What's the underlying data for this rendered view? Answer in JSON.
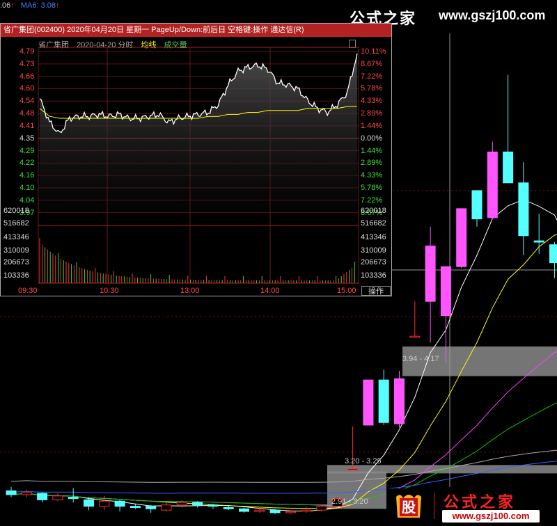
{
  "top_bar": {
    "ma_prefix": ".06",
    "ma5_label": "MA6: 3.08",
    "arrow": "↑"
  },
  "watermark_top": {
    "cn": "公式之家",
    "url": "www.gszj100.com"
  },
  "watermark_bottom": {
    "cn": "公式之家",
    "url": "www.gszj100.com",
    "seal_char": "股"
  },
  "zones": [
    {
      "label": "3.94 - 4.17"
    },
    {
      "label": "3.20 - 3.25"
    },
    {
      "label": "2.91 - 3.20"
    }
  ],
  "popup": {
    "title": "省广集团(002400) 2020年04月20日 星期一 PageUp/Down:前后日 空格键:操作 通达信(R)",
    "stock_name": "省广集团",
    "date": "2020-04-20 分时",
    "avg_label": "均线",
    "vol_label": "成交量",
    "price_labels": [
      "4.79",
      "4.73",
      "4.66",
      "4.60",
      "4.54",
      "4.48",
      "4.41",
      "4.35",
      "4.29",
      "4.22",
      "4.16",
      "4.10",
      "4.04",
      "3.97"
    ],
    "pct_labels": [
      "10.11%",
      "8.67%",
      "7.22%",
      "5.78%",
      "4.33%",
      "2.89%",
      "1.44%",
      "0.00%",
      "1.44%",
      "2.89%",
      "4.33%",
      "5.78%",
      "7.22%",
      "8.67%"
    ],
    "vol_labels": [
      "620018",
      "516682",
      "413346",
      "310009",
      "206673",
      "103336"
    ],
    "time_labels": [
      "09:30",
      "10:30",
      "13:00",
      "14:00",
      "15:00"
    ],
    "op_button": "操作"
  },
  "colors": {
    "up": "#ff55ff",
    "down": "#55ffff",
    "up_price_label": "#ff4a4a",
    "down_price_label": "#3fe03f",
    "title_bar": "#b22222",
    "avg_line": "#ffff00"
  },
  "chart_data": [
    {
      "type": "candlestick",
      "candles": [
        [
          3.05,
          3.02,
          3.08,
          3.0
        ],
        [
          3.02,
          3.04,
          3.06,
          3.0
        ],
        [
          3.03,
          2.98,
          3.04,
          2.96
        ],
        [
          2.98,
          3.01,
          3.03,
          2.97
        ],
        [
          3.0,
          2.99,
          3.07,
          2.96
        ],
        [
          2.98,
          2.93,
          3.0,
          2.9
        ],
        [
          2.93,
          2.97,
          3.01,
          2.9
        ],
        [
          2.97,
          2.93,
          2.98,
          2.89
        ],
        [
          2.93,
          2.92,
          2.95,
          2.91
        ],
        [
          2.93,
          2.91,
          2.94,
          2.88
        ],
        [
          2.9,
          2.94,
          2.96,
          2.89
        ],
        [
          2.94,
          2.96,
          2.98,
          2.92
        ],
        [
          2.96,
          2.94,
          2.97,
          2.92
        ],
        [
          2.94,
          2.93,
          2.95,
          2.91
        ],
        [
          2.92,
          2.91,
          2.93,
          2.9
        ],
        [
          2.91,
          2.89,
          2.92,
          2.88
        ],
        [
          2.89,
          2.9,
          2.92,
          2.88
        ],
        [
          2.9,
          2.88,
          2.91,
          2.87
        ],
        [
          2.88,
          2.89,
          2.9,
          2.87
        ],
        [
          2.89,
          2.9,
          2.93,
          2.88
        ],
        [
          2.9,
          2.93,
          2.94,
          2.89
        ],
        [
          2.93,
          2.99,
          3.0,
          2.92
        ],
        [
          3.22,
          3.22,
          3.55,
          3.22
        ],
        [
          3.56,
          3.91,
          3.91,
          3.56
        ],
        [
          3.91,
          3.58,
          3.99,
          3.56
        ],
        [
          3.57,
          3.92,
          3.98,
          3.54
        ],
        [
          4.25,
          4.25,
          4.52,
          4.25
        ],
        [
          4.52,
          4.95,
          5.1,
          4.2
        ],
        [
          4.41,
          4.79,
          4.79,
          4.04
        ],
        [
          4.79,
          5.24,
          5.24,
          4.78
        ],
        [
          5.38,
          5.16,
          5.38,
          5.1
        ],
        [
          5.17,
          5.68,
          5.76,
          5.16
        ],
        [
          5.68,
          5.44,
          6.28,
          5.44
        ],
        [
          5.44,
          5.03,
          5.6,
          4.88
        ],
        [
          4.99,
          4.98,
          5.2,
          4.89
        ],
        [
          4.96,
          4.82,
          4.98,
          4.7
        ],
        [
          4.7,
          4.45,
          4.76,
          4.35
        ]
      ],
      "ma_lines": [
        {
          "name": "MA5",
          "color": "#ffffff"
        },
        {
          "name": "MA10",
          "color": "#ffff00"
        },
        {
          "name": "MA20",
          "color": "#ff44ff"
        },
        {
          "name": "MA30",
          "color": "#00cc00"
        },
        {
          "name": "MA60",
          "color": "#3366ff"
        },
        {
          "name": "MA120",
          "color": "#aaaaaa"
        }
      ]
    },
    {
      "type": "line",
      "series": [
        {
          "values": [
            4.55,
            4.43,
            4.37,
            4.45,
            4.46,
            4.46,
            4.47,
            4.46,
            4.47,
            4.45,
            4.45,
            4.46,
            4.47,
            4.43,
            4.45,
            4.46,
            4.47,
            4.48,
            4.52,
            4.62,
            4.69,
            4.71,
            4.72,
            4.7,
            4.63,
            4.62,
            4.6,
            4.54,
            4.5,
            4.48,
            4.52,
            4.58,
            4.78
          ]
        },
        {
          "values": [
            4.5,
            4.46,
            4.45,
            4.45,
            4.45,
            4.45,
            4.45,
            4.45,
            4.45,
            4.45,
            4.45,
            4.45,
            4.45,
            4.45,
            4.45,
            4.45,
            4.45,
            4.46,
            4.46,
            4.47,
            4.47,
            4.48,
            4.48,
            4.49,
            4.49,
            4.49,
            4.49,
            4.5,
            4.5,
            4.5,
            4.5,
            4.51,
            4.51
          ]
        }
      ],
      "ylim": [
        3.92,
        4.79
      ]
    }
  ]
}
